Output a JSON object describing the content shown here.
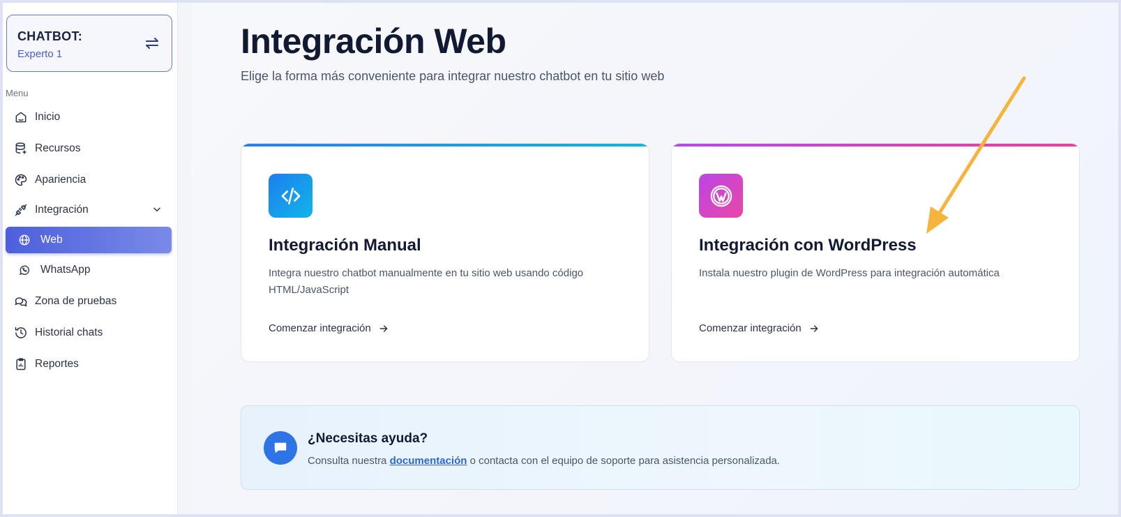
{
  "sidebar": {
    "bot_title": "CHATBOT:",
    "bot_name": "Experto 1",
    "menu_label": "Menu",
    "items": {
      "inicio": "Inicio",
      "recursos": "Recursos",
      "apariencia": "Apariencia",
      "integracion": "Integración",
      "web": "Web",
      "whatsapp": "WhatsApp",
      "zona": "Zona de pruebas",
      "historial": "Historial chats",
      "reportes": "Reportes"
    }
  },
  "main": {
    "title": "Integración Web",
    "subtitle": "Elige la forma más conveniente para integrar nuestro chatbot en tu sitio web",
    "cards": {
      "manual": {
        "title": "Integración Manual",
        "description": "Integra nuestro chatbot manualmente en tu sitio web usando código HTML/JavaScript",
        "cta": "Comenzar integración"
      },
      "wordpress": {
        "title": "Integración con WordPress",
        "description": "Instala nuestro plugin de WordPress para integración automática",
        "cta": "Comenzar integración"
      }
    },
    "help": {
      "title": "¿Necesitas ayuda?",
      "text_before": "Consulta nuestra ",
      "link": "documentación",
      "text_after": " o contacta con el equipo de soporte para asistencia personalizada."
    }
  },
  "colors": {
    "accent": "#4d5fdc",
    "annotation_arrow": "#f5b43c"
  }
}
